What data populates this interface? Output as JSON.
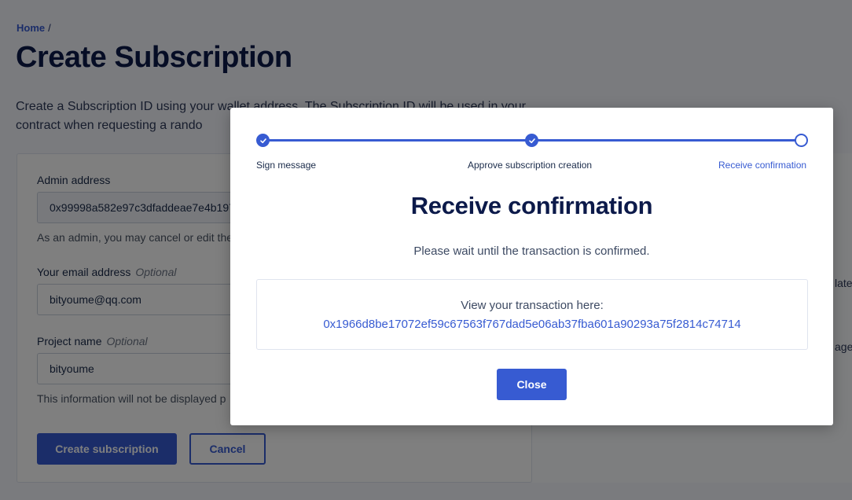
{
  "breadcrumb": {
    "home": "Home",
    "separator": "/"
  },
  "page": {
    "title": "Create Subscription",
    "intro": "Create a Subscription ID using your wallet address. The Subscription ID will be used in your contract when requesting a rando"
  },
  "form": {
    "admin_label": "Admin address",
    "admin_value": "0x99998a582e97c3dfaddeae7e4b197",
    "admin_help": "As an admin, you may cancel or edit the",
    "email_label": "Your email address",
    "email_optional": "Optional",
    "email_value": "bityoume@qq.com",
    "project_label": "Project name",
    "project_optional": "Optional",
    "project_value": "bityoume",
    "info_help": "This information will not be displayed p",
    "create_button": "Create subscription",
    "cancel_button": "Cancel"
  },
  "right_panel": {
    "text_1": "late",
    "text_2": "age"
  },
  "modal": {
    "steps": [
      {
        "label": "Sign message",
        "status": "done"
      },
      {
        "label": "Approve subscription creation",
        "status": "done"
      },
      {
        "label": "Receive confirmation",
        "status": "current"
      }
    ],
    "title": "Receive confirmation",
    "subtitle": "Please wait until the transaction is confirmed.",
    "tx_label": "View your transaction here:",
    "tx_hash": "0x1966d8be17072ef59c67563f767dad5e06ab37fba601a90293a75f2814c74714",
    "close_button": "Close"
  },
  "colors": {
    "accent": "#375bd2",
    "heading": "#0c1a4a",
    "overlay": "rgba(0,0,0,0.5)"
  }
}
